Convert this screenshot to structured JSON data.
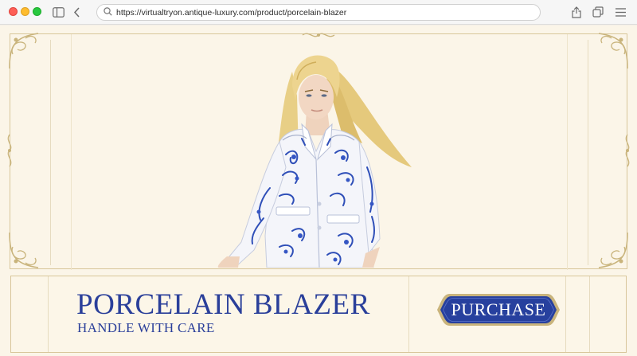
{
  "browser": {
    "url": "https://virtualtryon.antique-luxury.com/product/porcelain-blazer",
    "icons": [
      "sidebar-icon",
      "back-icon",
      "search-icon",
      "share-icon",
      "tabs-icon",
      "menu-icon"
    ]
  },
  "product": {
    "title": "PORCELAIN BLAZER",
    "subtitle": "HANDLE WITH CARE",
    "purchase_label": "PURCHASE"
  },
  "colors": {
    "accent_blue": "#2a3f9a",
    "gold": "#c9b47c",
    "background": "#fbf5e8"
  }
}
